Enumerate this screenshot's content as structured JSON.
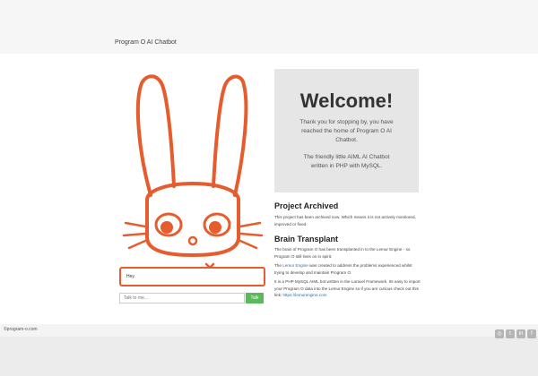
{
  "header": {
    "brand": "Program O AI Chatbot"
  },
  "chat": {
    "bot_reply": "Hey.",
    "input_placeholder": "Talk to me...",
    "talk_label": "Talk"
  },
  "welcome": {
    "title": "Welcome!",
    "line1": "Thank you for stopping by, you have reached the home of Program O AI Chatbot.",
    "line2": "The friendly little AIML AI Chatbot written in PHP with MySQL."
  },
  "archived": {
    "heading": "Project Archived",
    "text": "This project has been archived now. Which means it is not actively monitored, improved or fixed."
  },
  "transplant": {
    "heading": "Brain Transplant",
    "p1": "The brain of Program O has been transplanted in to the Lemur Engine - so Program O still lives on in spirit.",
    "p2_pre": "The ",
    "p2_link": "Lemur Engine",
    "p2_post": " was created to address the problems experienced whilst trying to develop and maintain Program O.",
    "p3_pre": "It is a PHP MySQL AIML bot written in the Laravel Framework. Its easy to import your Program O data into the Lemur Engine so if you are curious check out this link: ",
    "p3_link": "https://lemurengine.com"
  },
  "footer": {
    "copyright": "©program-o.com"
  },
  "icons": [
    "github-icon",
    "twitter-icon",
    "linkedin-icon",
    "facebook-icon"
  ],
  "colors": {
    "accent": "#e65c2c",
    "button": "#5cb85c",
    "link": "#2a6fb0"
  }
}
